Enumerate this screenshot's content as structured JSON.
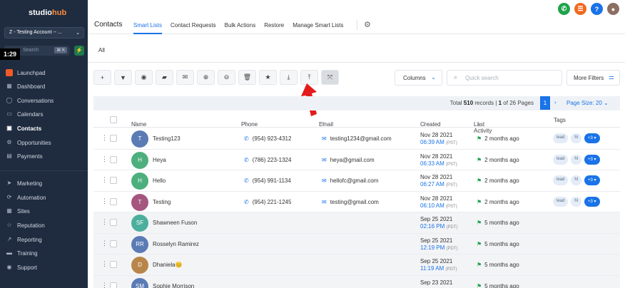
{
  "sidebar": {
    "logo_a": "studio",
    "logo_b": "hub",
    "account": "Z - Testing Account -- ...",
    "search_placeholder": "Search",
    "search_shortcut": "⌘ K",
    "timer": "1:29",
    "items": [
      {
        "label": "Launchpad",
        "icon": "rocket-icon"
      },
      {
        "label": "Dashboard",
        "icon": "dashboard-icon"
      },
      {
        "label": "Conversations",
        "icon": "chat-icon"
      },
      {
        "label": "Calendars",
        "icon": "calendar-icon"
      },
      {
        "label": "Contacts",
        "icon": "contacts-icon",
        "active": true
      },
      {
        "label": "Opportunities",
        "icon": "funnel-icon"
      },
      {
        "label": "Payments",
        "icon": "payments-icon"
      },
      {
        "label": "Marketing",
        "icon": "send-icon"
      },
      {
        "label": "Automation",
        "icon": "automation-icon"
      },
      {
        "label": "Sites",
        "icon": "sites-icon"
      },
      {
        "label": "Reputation",
        "icon": "star-icon"
      },
      {
        "label": "Reporting",
        "icon": "chart-icon"
      },
      {
        "label": "Training",
        "icon": "book-icon"
      },
      {
        "label": "Support",
        "icon": "support-icon"
      }
    ]
  },
  "header": {
    "title": "Contacts",
    "tabs": [
      "Smart Lists",
      "Contact Requests",
      "Bulk Actions",
      "Restore",
      "Manage Smart Lists"
    ],
    "active_tab": "Smart Lists"
  },
  "subtab": {
    "label": "All"
  },
  "toolbar": {
    "columns_label": "Columns",
    "search_placeholder": "Quick search",
    "more_filters_label": "More Filters"
  },
  "pagination": {
    "total_prefix": "Total",
    "total": "510",
    "records_label": "records |",
    "page": "1",
    "of_pages": "of 26 Pages",
    "current_page": "1",
    "page_size": "Page Size: 20"
  },
  "table": {
    "headers": [
      "Name",
      "Phone",
      "Email",
      "Created",
      "Last Activity",
      "Tags"
    ],
    "rows": [
      {
        "initial": "T",
        "color": "#5b7bb5",
        "name": "Testing123",
        "phone": "(954) 923-4312",
        "email": "testing1234@gmail.com",
        "date": "Nov 28 2021",
        "time": "06:39 AM",
        "tz": "(PST)",
        "activity": "2 months ago",
        "tags": [
          "lead",
          "hl",
          "+3 ▾"
        ]
      },
      {
        "initial": "H",
        "color": "#4caf7d",
        "name": "Heya",
        "phone": "(786) 223-1324",
        "email": "heya@gmail.com",
        "date": "Nov 28 2021",
        "time": "06:33 AM",
        "tz": "(PST)",
        "activity": "2 months ago",
        "tags": [
          "lead",
          "hl",
          "+3 ▾"
        ]
      },
      {
        "initial": "H",
        "color": "#4caf7d",
        "name": "Hello",
        "phone": "(954) 991-1134",
        "email": "hellofc@gmail.com",
        "date": "Nov 28 2021",
        "time": "06:27 AM",
        "tz": "(PST)",
        "activity": "2 months ago",
        "tags": [
          "lead",
          "hl",
          "+3 ▾"
        ]
      },
      {
        "initial": "T",
        "color": "#a5567f",
        "name": "Testing",
        "phone": "(954) 221-1245",
        "email": "testing@gmail.com",
        "date": "Nov 28 2021",
        "time": "06:10 AM",
        "tz": "(PST)",
        "activity": "2 months ago",
        "tags": [
          "lead",
          "hl",
          "+3 ▾"
        ]
      },
      {
        "initial": "SF",
        "color": "#4caf9d",
        "name": "Shawneen Fuson",
        "phone": "",
        "email": "",
        "date": "Sep 25 2021",
        "time": "02:16 PM",
        "tz": "(PDT)",
        "activity": "5 months ago",
        "tags": []
      },
      {
        "initial": "RR",
        "color": "#5b7bb5",
        "name": "Rosselyn Ramirez",
        "phone": "",
        "email": "",
        "date": "Sep 25 2021",
        "time": "12:19 PM",
        "tz": "(PDT)",
        "activity": "5 months ago",
        "tags": []
      },
      {
        "initial": "D",
        "color": "#b8864a",
        "name": "Dhaniela😊",
        "phone": "",
        "email": "",
        "date": "Sep 25 2021",
        "time": "11:19 AM",
        "tz": "(PDT)",
        "activity": "5 months ago",
        "tags": []
      },
      {
        "initial": "SM",
        "color": "#5b7bb5",
        "name": "Sophie Morrison",
        "phone": "",
        "email": "",
        "date": "Sep 23 2021",
        "time": "",
        "tz": "",
        "activity": "5 months ago",
        "tags": []
      }
    ]
  },
  "colors": {
    "accent": "#1a73e8",
    "sidebar": "#1f2c3f",
    "arrow": "#e31b1b"
  }
}
